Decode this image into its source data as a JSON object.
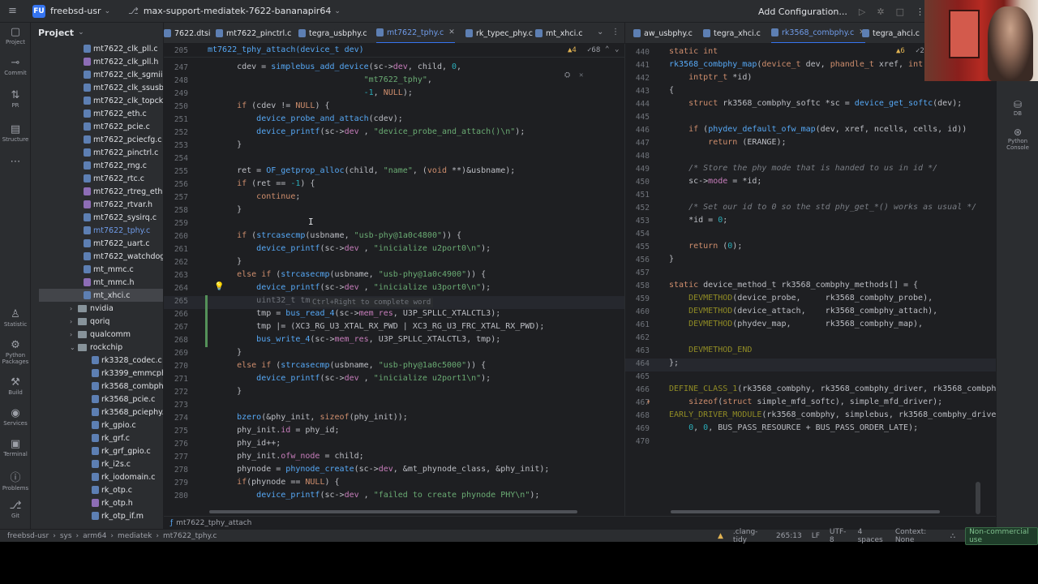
{
  "titlebar": {
    "project_badge": "FU",
    "project_name": "freebsd-usr",
    "branch": "max-support-mediatek-7622-bananapir64",
    "run_config": "Add Configuration..."
  },
  "project_panel": {
    "title": "Project",
    "files": [
      {
        "name": "mt7622_clk_pll.c",
        "type": "c"
      },
      {
        "name": "mt7622_clk_pll.h",
        "type": "h"
      },
      {
        "name": "mt7622_clk_sgmii.c",
        "type": "c"
      },
      {
        "name": "mt7622_clk_ssusbsys",
        "type": "c"
      },
      {
        "name": "mt7622_clk_topckgen",
        "type": "c"
      },
      {
        "name": "mt7622_eth.c",
        "type": "c"
      },
      {
        "name": "mt7622_pcie.c",
        "type": "c"
      },
      {
        "name": "mt7622_pciecfg.c",
        "type": "c"
      },
      {
        "name": "mt7622_pinctrl.c",
        "type": "c"
      },
      {
        "name": "mt7622_rng.c",
        "type": "c"
      },
      {
        "name": "mt7622_rtc.c",
        "type": "c"
      },
      {
        "name": "mt7622_rtreg_eth.h",
        "type": "h"
      },
      {
        "name": "mt7622_rtvar.h",
        "type": "h"
      },
      {
        "name": "mt7622_sysirq.c",
        "type": "c"
      },
      {
        "name": "mt7622_tphy.c",
        "type": "c",
        "modified": true
      },
      {
        "name": "mt7622_uart.c",
        "type": "c"
      },
      {
        "name": "mt7622_watchdog.c",
        "type": "c"
      },
      {
        "name": "mt_mmc.c",
        "type": "c"
      },
      {
        "name": "mt_mmc.h",
        "type": "h"
      },
      {
        "name": "mt_xhci.c",
        "type": "c",
        "selected": true
      }
    ],
    "folders": [
      "nvidia",
      "qoriq",
      "qualcomm",
      "rockchip"
    ],
    "rockchip_files": [
      {
        "name": "rk3328_codec.c",
        "type": "c"
      },
      {
        "name": "rk3399_emmcphy.c",
        "type": "c"
      },
      {
        "name": "rk3568_combphy.c",
        "type": "c"
      },
      {
        "name": "rk3568_pcie.c",
        "type": "c"
      },
      {
        "name": "rk3568_pciephy.c",
        "type": "c"
      },
      {
        "name": "rk_gpio.c",
        "type": "c"
      },
      {
        "name": "rk_grf.c",
        "type": "c"
      },
      {
        "name": "rk_grf_gpio.c",
        "type": "c"
      },
      {
        "name": "rk_i2s.c",
        "type": "c"
      },
      {
        "name": "rk_iodomain.c",
        "type": "c"
      },
      {
        "name": "rk_otp.c",
        "type": "c"
      },
      {
        "name": "rk_otp.h",
        "type": "h"
      },
      {
        "name": "rk_otp_if.m",
        "type": "c"
      }
    ]
  },
  "left_strip": [
    {
      "icon": "▢",
      "label": "Project"
    },
    {
      "icon": "⊸",
      "label": "Commit"
    },
    {
      "icon": "⇅",
      "label": "PR"
    },
    {
      "icon": "▤",
      "label": "Structure"
    },
    {
      "icon": "⋯",
      "label": ""
    },
    {
      "icon": "♙",
      "label": "Statistic"
    },
    {
      "icon": "⚙",
      "label": "Python Packages"
    },
    {
      "icon": "⚒",
      "label": "Build"
    },
    {
      "icon": "◉",
      "label": "Services"
    },
    {
      "icon": "▣",
      "label": "Terminal"
    },
    {
      "icon": "ⓘ",
      "label": "Problems"
    },
    {
      "icon": "⎇",
      "label": "Git"
    }
  ],
  "right_strip": [
    {
      "icon": "⛁",
      "label": "DB"
    },
    {
      "icon": "⊛",
      "label": "Python Console"
    }
  ],
  "left_tabs": [
    "7622.dtsi",
    "mt7622_pinctrl.c",
    "tegra_usbphy.c",
    "mt7622_tphy.c",
    "rk_typec_phy.c",
    "mt_xhci.c"
  ],
  "left_active_tab": "mt7622_tphy.c",
  "right_tabs": [
    "aw_usbphy.c",
    "tegra_xhci.c",
    "rk3568_combphy.c",
    "tegra_ahci.c"
  ],
  "right_active_tab": "rk3568_combphy.c",
  "left_editor": {
    "sticky_line": "205",
    "sticky_text": "mt7622_tphy_attach(device_t dev)",
    "inspection_warn": "▲4",
    "inspection_ok": "✓68",
    "lines": [
      "247",
      "248",
      "249",
      "250",
      "251",
      "252",
      "253",
      "254",
      "255",
      "256",
      "257",
      "258",
      "259",
      "260",
      "261",
      "262",
      "263",
      "264",
      "265",
      "266",
      "267",
      "268",
      "269",
      "270",
      "271",
      "272",
      "273",
      "274",
      "275",
      "276",
      "277",
      "278",
      "279",
      "280"
    ],
    "completion_hint": "Ctrl+Right  to complete word"
  },
  "right_editor": {
    "lines": [
      "440",
      "441",
      "442",
      "443",
      "444",
      "445",
      "446",
      "447",
      "448",
      "449",
      "450",
      "451",
      "452",
      "453",
      "454",
      "455",
      "456",
      "457",
      "458",
      "459",
      "460",
      "461",
      "462",
      "463",
      "464",
      "465",
      "466",
      "467",
      "468",
      "469",
      "470"
    ],
    "inspection_warn": "▲6",
    "inspection_ok": "✓2"
  },
  "navbar": {
    "func": "mt7622_tphy_attach"
  },
  "statusbar": {
    "crumbs": [
      "freebsd-usr",
      "sys",
      "arm64",
      "mediatek",
      "mt7622_tphy.c"
    ],
    "clang": ".clang-tidy",
    "position": "265:13",
    "line_sep": "LF",
    "encoding": "UTF-8",
    "indent": "4 spaces",
    "context": "Context: None",
    "license": "Non-commercial use"
  }
}
